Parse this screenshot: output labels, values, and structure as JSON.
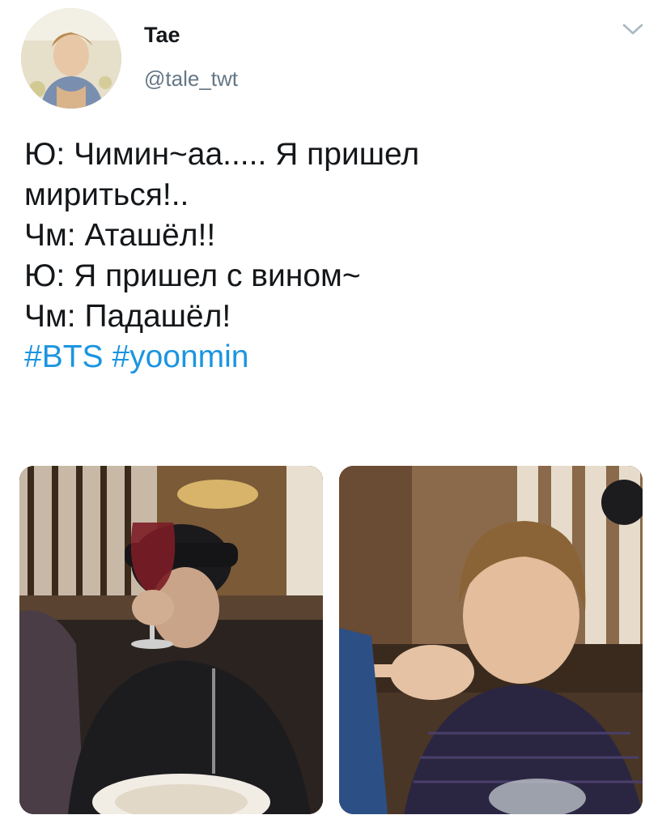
{
  "tweet": {
    "author": {
      "display_name": "Tae",
      "handle": "@tale_twt",
      "avatar_icon": "user-avatar"
    },
    "menu_icon": "chevron-down-icon",
    "text_lines": [
      "Ю: Чимин~аа..... Я пришел",
      "мириться!..",
      "Чм: Аташёл!!",
      "Ю: Я пришел с вином~",
      "Чм: Падашёл!"
    ],
    "hashtags": [
      "#BTS",
      "#yoonmin"
    ],
    "hashtag_color": "#1b95e0",
    "media": [
      {
        "type": "photo"
      },
      {
        "type": "photo"
      }
    ]
  }
}
